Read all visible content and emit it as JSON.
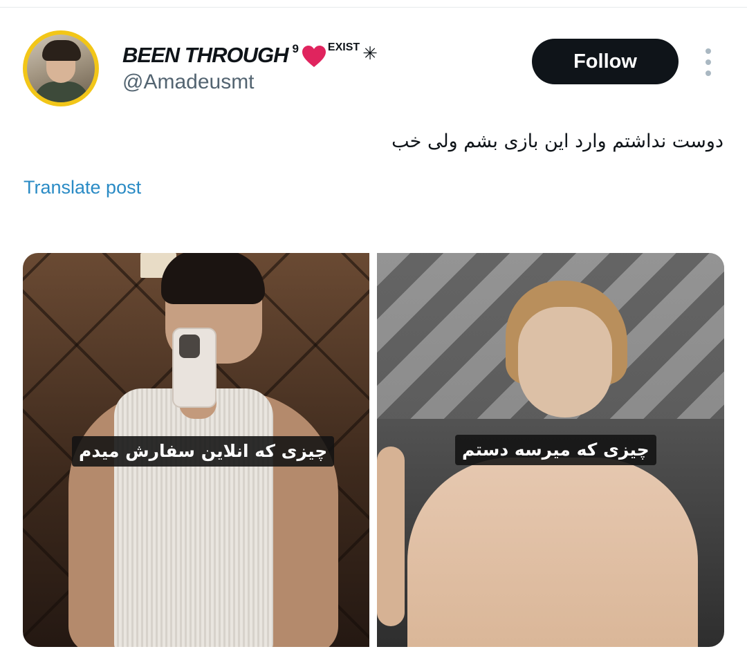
{
  "author": {
    "display_name": "BEEN THROUGH",
    "superscript_number": "9",
    "exist_tag": "EXIST",
    "handle": "@Amadeusmt",
    "avatar_icon": "avatar-icon",
    "avatar_ring_color": "#f2c618"
  },
  "actions": {
    "follow_label": "Follow",
    "more_icon": "more-vertical-icon"
  },
  "post": {
    "text": "دوست نداشتم وارد این بازی بشم ولی خب",
    "translate_label": "Translate post"
  },
  "media": [
    {
      "caption": "چیزی که انلاین سفارش میدم"
    },
    {
      "caption": "چیزی که میرسه دستم"
    }
  ],
  "colors": {
    "follow_bg": "#0f1419",
    "translate_link": "#2a8bc5",
    "handle_gray": "#536471",
    "heart": "#e0245e"
  }
}
